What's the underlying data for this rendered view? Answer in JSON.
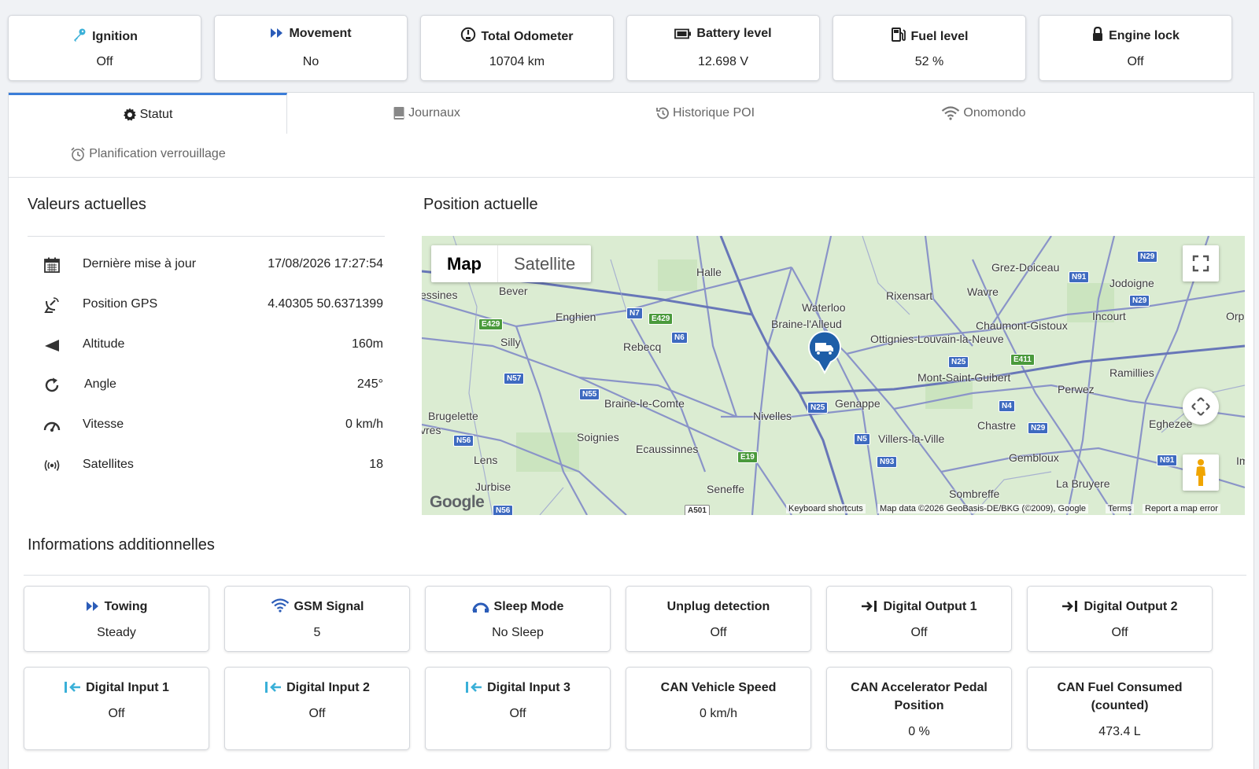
{
  "top_stats": [
    {
      "label": "Ignition",
      "value": "Off",
      "icon": "key-icon"
    },
    {
      "label": "Movement",
      "value": "No",
      "icon": "fast-forward-icon"
    },
    {
      "label": "Total Odometer",
      "value": "10704 km",
      "icon": "odometer-icon"
    },
    {
      "label": "Battery level",
      "value": "12.698 V",
      "icon": "battery-icon"
    },
    {
      "label": "Fuel level",
      "value": "52 %",
      "icon": "fuel-pump-icon"
    },
    {
      "label": "Engine lock",
      "value": "Off",
      "icon": "lock-icon"
    }
  ],
  "tabs": [
    {
      "label": "Statut",
      "icon": "gear-icon",
      "active": true
    },
    {
      "label": "Journaux",
      "icon": "book-icon",
      "active": false
    },
    {
      "label": "Historique POI",
      "icon": "history-icon",
      "active": false
    },
    {
      "label": "Onomondo",
      "icon": "wifi-icon",
      "active": false
    },
    {
      "label": "Planification verrouillage",
      "icon": "alarm-clock-icon",
      "active": false
    }
  ],
  "current_values": {
    "title": "Valeurs actuelles",
    "rows": [
      {
        "label": "Dernière mise à jour",
        "value": "17/08/2026 17:27:54",
        "icon": "calendar-icon"
      },
      {
        "label": "Position GPS",
        "value": "4.40305 50.6371399",
        "icon": "satellite-dish-icon"
      },
      {
        "label": "Altitude",
        "value": "160m",
        "icon": "altitude-icon"
      },
      {
        "label": "Angle",
        "value": "245°",
        "icon": "rotate-icon"
      },
      {
        "label": "Vitesse",
        "value": "0 km/h",
        "icon": "speedometer-icon"
      },
      {
        "label": "Satellites",
        "value": "18",
        "icon": "broadcast-icon"
      }
    ]
  },
  "position": {
    "title": "Position actuelle",
    "map_type_buttons": {
      "map": "Map",
      "satellite": "Satellite"
    },
    "logo": "Google",
    "footer": {
      "shortcuts": "Keyboard shortcuts",
      "attribution": "Map data ©2026 GeoBasis-DE/BKG (©2009), Google",
      "terms": "Terms",
      "report": "Report a map error"
    },
    "towns": [
      "Halle",
      "Grez-Doiceau",
      "Jodoigne",
      "essines",
      "Bever",
      "Rixensart",
      "Wavre",
      "Waterloo",
      "Enghien",
      "Braine-l'Alleud",
      "Chaumont-Gistoux",
      "Incourt",
      "Orp-Jau",
      "Silly",
      "Rebecq",
      "Ottignies-Louvain-la-Neuve",
      "Ramillies",
      "Mont-Saint-Guibert",
      "Perwez",
      "Brugelette",
      "Braine-le-Comte",
      "Nivelles",
      "Genappe",
      "vres",
      "Soignies",
      "Chastre",
      "Eghezee",
      "Villers-la-Ville",
      "Lens",
      "Ecaussinnes",
      "Gembloux",
      "Im",
      "Jurbise",
      "La Bruyere",
      "Seneffe",
      "Sombreffe"
    ],
    "road_signs": [
      "N29",
      "N91",
      "N29",
      "E429",
      "N7",
      "E429",
      "N6",
      "N25",
      "E411",
      "N57",
      "N55",
      "N4",
      "N25",
      "N29",
      "N56",
      "N5",
      "N93",
      "E19",
      "N91",
      "N56",
      "A501"
    ]
  },
  "additional": {
    "title": "Informations additionnelles",
    "cards": [
      {
        "label": "Towing",
        "value": "Steady",
        "icon": "fast-forward-icon"
      },
      {
        "label": "GSM Signal",
        "value": "5",
        "icon": "wifi-icon"
      },
      {
        "label": "Sleep Mode",
        "value": "No Sleep",
        "icon": "sleep-icon"
      },
      {
        "label": "Unplug detection",
        "value": "Off",
        "icon": ""
      },
      {
        "label": "Digital Output 1",
        "value": "Off",
        "icon": "output-arrow-icon"
      },
      {
        "label": "Digital Output 2",
        "value": "Off",
        "icon": "output-arrow-icon"
      },
      {
        "label": "Digital Input 1",
        "value": "Off",
        "icon": "input-arrow-icon"
      },
      {
        "label": "Digital Input 2",
        "value": "Off",
        "icon": "input-arrow-icon"
      },
      {
        "label": "Digital Input 3",
        "value": "Off",
        "icon": "input-arrow-icon"
      },
      {
        "label": "CAN Vehicle Speed",
        "value": "0 km/h",
        "icon": ""
      },
      {
        "label": "CAN Accelerator Pedal Position",
        "value": "0 %",
        "icon": ""
      },
      {
        "label": "CAN Fuel Consumed (counted)",
        "value": "473.4 L",
        "icon": ""
      }
    ]
  },
  "colors": {
    "accent": "#3b7dd8",
    "icon_blue": "#2b5cb8",
    "icon_cyan": "#3ab0d8",
    "map_bg": "#dbecd2",
    "map_road": "#7b87c4",
    "marker": "#1e5ea8"
  }
}
